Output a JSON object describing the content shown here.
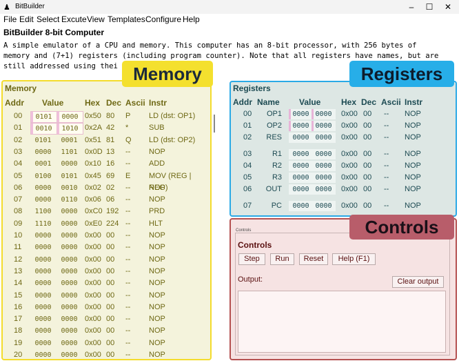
{
  "window": {
    "title": "BitBuilder",
    "min": "–",
    "max": "☐",
    "close": "✕"
  },
  "menu": [
    "File",
    "Edit",
    "Select",
    "Excute",
    "View",
    "Templates",
    "Configure",
    "Help"
  ],
  "app": {
    "title": "BitBuilder 8-bit Computer",
    "desc_lines": [
      "A simple emulator of a CPU and memory. This computer has an 8-bit processor, with 256 bytes of",
      "memory and (7+1) registers (including program counter). Note that all registers have names, but are",
      "still addressed using thei"
    ]
  },
  "callouts": {
    "memory": "Memory",
    "registers": "Registers",
    "controls": "Controls"
  },
  "memory": {
    "label": "Memory",
    "headers": {
      "addr": "Addr",
      "value": "Value",
      "hex": "Hex",
      "dec": "Dec",
      "ascii": "Ascii",
      "instr": "Instr"
    },
    "rows": [
      {
        "addr": "00",
        "v1": "0101",
        "v2": "0000",
        "hex": "0x50",
        "dec": "80",
        "ascii": "P",
        "instr": "LD (dst: OP1)"
      },
      {
        "addr": "01",
        "v1": "0010",
        "v2": "1010",
        "hex": "0x2A",
        "dec": "42",
        "ascii": "*",
        "instr": "SUB"
      },
      {
        "addr": "02",
        "v1": "0101",
        "v2": "0001",
        "hex": "0x51",
        "dec": "81",
        "ascii": "Q",
        "instr": "LD (dst: OP2)"
      },
      {
        "addr": "03",
        "v1": "0000",
        "v2": "1101",
        "hex": "0x0D",
        "dec": "13",
        "ascii": "--",
        "instr": "NOP"
      },
      {
        "addr": "04",
        "v1": "0001",
        "v2": "0000",
        "hex": "0x10",
        "dec": "16",
        "ascii": "--",
        "instr": "ADD"
      },
      {
        "addr": "05",
        "v1": "0100",
        "v2": "0101",
        "hex": "0x45",
        "dec": "69",
        "ascii": "E",
        "instr": "MOV (REG | REG)"
      },
      {
        "addr": "06",
        "v1": "0000",
        "v2": "0010",
        "hex": "0x02",
        "dec": "02",
        "ascii": "--",
        "instr": "NOP"
      },
      {
        "addr": "07",
        "v1": "0000",
        "v2": "0110",
        "hex": "0x06",
        "dec": "06",
        "ascii": "--",
        "instr": "NOP"
      },
      {
        "addr": "08",
        "v1": "1100",
        "v2": "0000",
        "hex": "0xC0",
        "dec": "192",
        "ascii": "--",
        "instr": "PRD"
      },
      {
        "addr": "09",
        "v1": "1110",
        "v2": "0000",
        "hex": "0xE0",
        "dec": "224",
        "ascii": "--",
        "instr": "HLT"
      },
      {
        "addr": "10",
        "v1": "0000",
        "v2": "0000",
        "hex": "0x00",
        "dec": "00",
        "ascii": "--",
        "instr": "NOP"
      },
      {
        "addr": "11",
        "v1": "0000",
        "v2": "0000",
        "hex": "0x00",
        "dec": "00",
        "ascii": "--",
        "instr": "NOP"
      },
      {
        "addr": "12",
        "v1": "0000",
        "v2": "0000",
        "hex": "0x00",
        "dec": "00",
        "ascii": "--",
        "instr": "NOP"
      },
      {
        "addr": "13",
        "v1": "0000",
        "v2": "0000",
        "hex": "0x00",
        "dec": "00",
        "ascii": "--",
        "instr": "NOP"
      },
      {
        "addr": "14",
        "v1": "0000",
        "v2": "0000",
        "hex": "0x00",
        "dec": "00",
        "ascii": "--",
        "instr": "NOP"
      },
      {
        "addr": "15",
        "v1": "0000",
        "v2": "0000",
        "hex": "0x00",
        "dec": "00",
        "ascii": "--",
        "instr": "NOP"
      },
      {
        "addr": "16",
        "v1": "0000",
        "v2": "0000",
        "hex": "0x00",
        "dec": "00",
        "ascii": "--",
        "instr": "NOP"
      },
      {
        "addr": "17",
        "v1": "0000",
        "v2": "0000",
        "hex": "0x00",
        "dec": "00",
        "ascii": "--",
        "instr": "NOP"
      },
      {
        "addr": "18",
        "v1": "0000",
        "v2": "0000",
        "hex": "0x00",
        "dec": "00",
        "ascii": "--",
        "instr": "NOP"
      },
      {
        "addr": "19",
        "v1": "0000",
        "v2": "0000",
        "hex": "0x00",
        "dec": "00",
        "ascii": "--",
        "instr": "NOP"
      },
      {
        "addr": "20",
        "v1": "0000",
        "v2": "0000",
        "hex": "0x00",
        "dec": "00",
        "ascii": "--",
        "instr": "NOP"
      }
    ]
  },
  "registers": {
    "label": "Registers",
    "headers": {
      "addr": "Addr",
      "name": "Name",
      "value": "Value",
      "hex": "Hex",
      "dec": "Dec",
      "ascii": "Ascii",
      "instr": "Instr"
    },
    "rows": [
      {
        "addr": "00",
        "name": "OP1",
        "v1": "0000",
        "v2": "0000",
        "hex": "0x00",
        "dec": "00",
        "ascii": "--",
        "instr": "NOP"
      },
      {
        "addr": "01",
        "name": "OP2",
        "v1": "0000",
        "v2": "0000",
        "hex": "0x00",
        "dec": "00",
        "ascii": "--",
        "instr": "NOP"
      },
      {
        "addr": "02",
        "name": "RES",
        "v1": "0000",
        "v2": "0000",
        "hex": "0x00",
        "dec": "00",
        "ascii": "--",
        "instr": "NOP"
      },
      {
        "addr": "03",
        "name": "R1",
        "v1": "0000",
        "v2": "0000",
        "hex": "0x00",
        "dec": "00",
        "ascii": "--",
        "instr": "NOP"
      },
      {
        "addr": "04",
        "name": "R2",
        "v1": "0000",
        "v2": "0000",
        "hex": "0x00",
        "dec": "00",
        "ascii": "--",
        "instr": "NOP"
      },
      {
        "addr": "05",
        "name": "R3",
        "v1": "0000",
        "v2": "0000",
        "hex": "0x00",
        "dec": "00",
        "ascii": "--",
        "instr": "NOP"
      },
      {
        "addr": "06",
        "name": "OUT",
        "v1": "0000",
        "v2": "0000",
        "hex": "0x00",
        "dec": "00",
        "ascii": "--",
        "instr": "NOP"
      },
      {
        "addr": "07",
        "name": "PC",
        "v1": "0000",
        "v2": "0000",
        "hex": "0x00",
        "dec": "00",
        "ascii": "--",
        "instr": "NOP"
      }
    ]
  },
  "controls": {
    "frame_label": "Controls",
    "heading": "Controls",
    "step": "Step",
    "run": "Run",
    "reset": "Reset",
    "help": "Help (F1)",
    "output_label": "Output:",
    "clear_output": "Clear output",
    "output": ""
  },
  "colors": {
    "memory_accent": "#f4dc2c",
    "registers_accent": "#2aa9e6",
    "controls_accent": "#b45050"
  }
}
